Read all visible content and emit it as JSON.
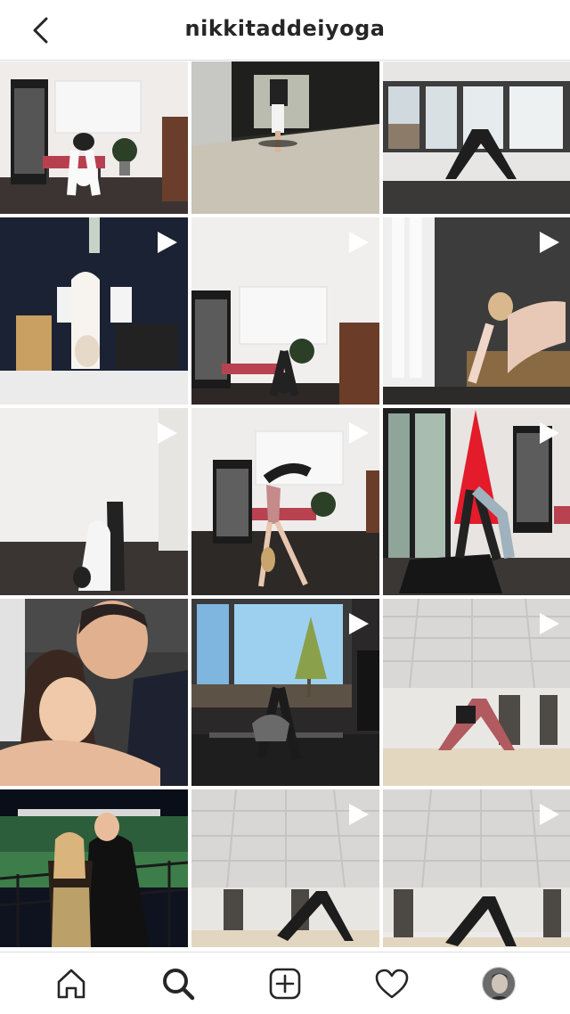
{
  "header": {
    "username": "nikkitaddeiyoga",
    "back_icon": "chevron-left-icon"
  },
  "grid": {
    "posts": [
      {
        "id": "post-1",
        "is_video": false,
        "scene": "studio-handstand-bench"
      },
      {
        "id": "post-2",
        "is_video": false,
        "scene": "tunnel-handstand"
      },
      {
        "id": "post-3",
        "is_video": false,
        "scene": "windows-downdog"
      },
      {
        "id": "post-4",
        "is_video": true,
        "scene": "dark-room-pose"
      },
      {
        "id": "post-5",
        "is_video": true,
        "scene": "studio-bench-forward-fold"
      },
      {
        "id": "post-6",
        "is_video": true,
        "scene": "window-lunge"
      },
      {
        "id": "post-7",
        "is_video": true,
        "scene": "wall-forward-fold"
      },
      {
        "id": "post-8",
        "is_video": true,
        "scene": "studio-leg-raise"
      },
      {
        "id": "post-9",
        "is_video": true,
        "scene": "christmas-tree-downdog"
      },
      {
        "id": "post-10",
        "is_video": false,
        "scene": "couple-selfie"
      },
      {
        "id": "post-11",
        "is_video": true,
        "scene": "window-wide-stance"
      },
      {
        "id": "post-12",
        "is_video": true,
        "scene": "loft-downdog"
      },
      {
        "id": "post-13",
        "is_video": false,
        "scene": "couple-racetrack"
      },
      {
        "id": "post-14",
        "is_video": true,
        "scene": "loft-downdog-2"
      },
      {
        "id": "post-15",
        "is_video": true,
        "scene": "loft-downdog-3"
      }
    ]
  },
  "bottom_nav": {
    "items": [
      {
        "name": "home",
        "icon": "home-icon"
      },
      {
        "name": "search",
        "icon": "search-icon",
        "active": true
      },
      {
        "name": "create",
        "icon": "plus-square-icon"
      },
      {
        "name": "activity",
        "icon": "heart-icon"
      },
      {
        "name": "profile",
        "icon": "avatar"
      }
    ]
  },
  "colors": {
    "text": "#262626",
    "border": "#dbdbdb",
    "background": "#ffffff"
  }
}
